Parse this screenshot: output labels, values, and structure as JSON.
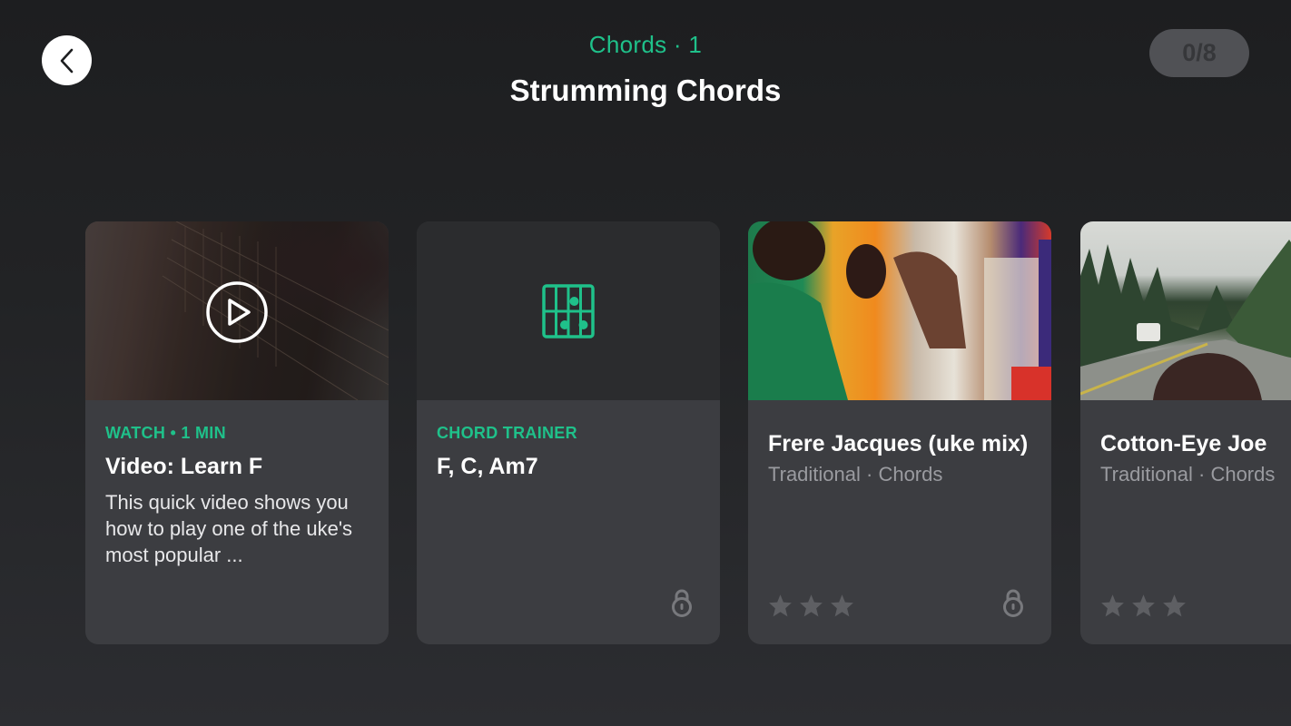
{
  "header": {
    "back_label": "Back",
    "subtitle": "Chords · 1",
    "title": "Strumming Chords",
    "progress": "0/8"
  },
  "colors": {
    "accent": "#1fc18a",
    "background": "#1d1e20",
    "card": "#3c3d41"
  },
  "cards": [
    {
      "type": "video",
      "eyebrow": "WATCH • 1 MIN",
      "title": "Video: Learn F",
      "description": "This quick video shows you how to play one of the uke's most popular ...",
      "icon": "play-icon",
      "locked": false
    },
    {
      "type": "chord-trainer",
      "eyebrow": "CHORD TRAINER",
      "title": "F, C, Am7",
      "icon": "chord-diagram-icon",
      "locked": true
    },
    {
      "type": "song",
      "title": "Frere Jacques (uke mix)",
      "meta": "Traditional · Chords",
      "stars_earned": 0,
      "stars_total": 3,
      "locked": true
    },
    {
      "type": "song",
      "title": "Cotton-Eye Joe",
      "meta": "Traditional · Chords",
      "stars_earned": 0,
      "stars_total": 3,
      "locked": false
    }
  ]
}
